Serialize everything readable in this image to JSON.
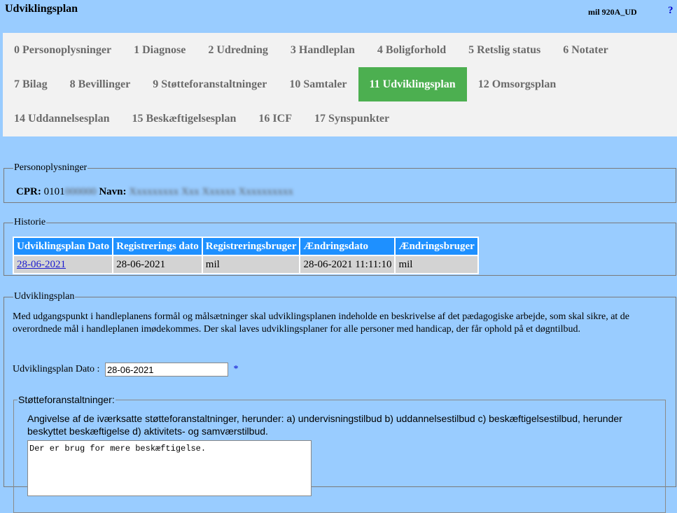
{
  "header": {
    "title": "Udviklingsplan",
    "user_code": "mil 920A_UD",
    "help": "?"
  },
  "tabs": {
    "row1": [
      "0 Personoplysninger",
      "1 Diagnose",
      "2 Udredning",
      "3 Handleplan",
      "4 Boligforhold",
      "5 Retslig status",
      "6 Notater"
    ],
    "row2": [
      "7 Bilag",
      "8 Bevillinger",
      "9 Støtteforanstaltninger",
      "10 Samtaler",
      "11 Udviklingsplan",
      "12 Omsorgsplan"
    ],
    "row3": [
      "14 Uddannelsesplan",
      "15 Beskæftigelsesplan",
      "16 ICF",
      "17 Synspunkter"
    ],
    "active": "11 Udviklingsplan"
  },
  "person": {
    "legend": "Personoplysninger",
    "cpr_label": "CPR:",
    "cpr_value": "0101",
    "cpr_blurred": "000000",
    "name_label": "Navn:",
    "name_blurred": "Xxxxxxxxx Xxx Xxxxxx Xxxxxxxxxx"
  },
  "history": {
    "legend": "Historie",
    "columns": [
      "Udviklingsplan Dato",
      "Registrerings dato",
      "Registreringsbruger",
      "Ændringsdato",
      "Ændringsbruger"
    ],
    "rows": [
      [
        "28-06-2021",
        "28-06-2021",
        "mil",
        "28-06-2021 11:11:10",
        "mil"
      ]
    ]
  },
  "plan": {
    "legend": "Udviklingsplan",
    "description": "Med udgangspunkt i handleplanens formål og målsætninger skal udviklingsplanen indeholde en beskrivelse af det pædagogiske arbejde, som skal sikre, at de overordnede mål i handleplanen imødekommes. Der skal laves udviklingsplaner for alle personer med handicap, der får ophold på et døgntilbud.",
    "date_label": "Udviklingsplan Dato :",
    "date_value": "28-06-2021",
    "required_mark": "*",
    "support": {
      "legend": "Støtteforanstaltninger:",
      "description": "Angivelse af de iværksatte støtteforanstaltninger, herunder: a) undervisningstilbud b) uddannelsestilbud c) beskæftigelsestilbud, herunder beskyttet beskæftigelse d) aktivitets- og samværstilbud.",
      "text": "Der er brug for mere beskæftigelse."
    }
  }
}
